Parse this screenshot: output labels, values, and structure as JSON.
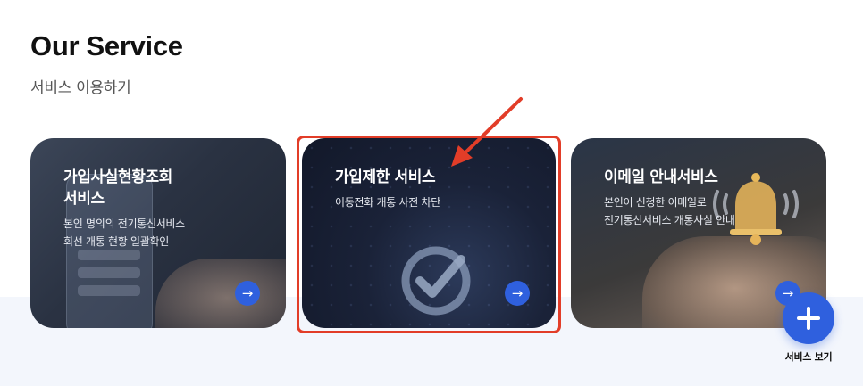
{
  "header": {
    "title": "Our Service",
    "subtitle": "서비스 이용하기"
  },
  "cards": [
    {
      "title_lines": [
        "가입사실현황조회",
        "서비스"
      ],
      "desc_lines": [
        "본인 명의의 전기통신서비스",
        "회선 개통 현황 일괄확인"
      ],
      "arrow": "→"
    },
    {
      "title_lines": [
        "가입제한 서비스"
      ],
      "desc_lines": [
        "이동전화 개통 사전 차단"
      ],
      "arrow": "→"
    },
    {
      "title_lines": [
        "이메일 안내서비스"
      ],
      "desc_lines": [
        "본인이 신청한 이메일로",
        "전기통신서비스 개통사실 안내"
      ],
      "arrow": "→"
    }
  ],
  "fab": {
    "label": "서비스 보기"
  },
  "colors": {
    "accent": "#2f60de",
    "annotation": "#e23d28",
    "band": "#f3f6fc"
  },
  "icons": {
    "card_arrow": "arrow-right-icon",
    "fab": "plus-icon",
    "card2_image": "check-circle-icon",
    "card3_image": "bell-icon"
  }
}
